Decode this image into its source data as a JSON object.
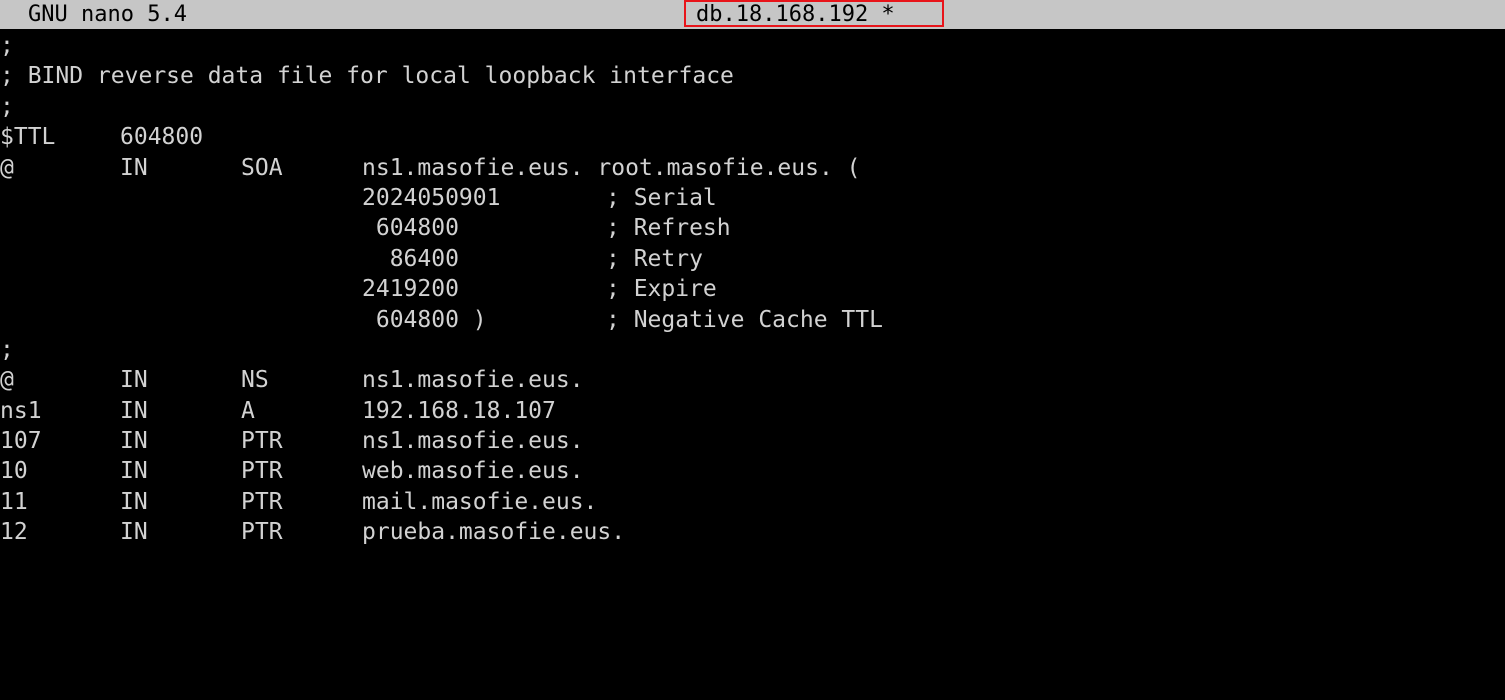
{
  "titlebar": {
    "app": "GNU nano 5.4",
    "file": "db.18.168.192 *"
  },
  "lines": [
    {
      "full": ";"
    },
    {
      "full": "; BIND reverse data file for local loopback interface"
    },
    {
      "full": ";"
    },
    {
      "name": "$TTL",
      "class": "604800"
    },
    {
      "name": "@",
      "class": "IN",
      "type": "SOA",
      "data": "ns1.masofie.eus. root.masofie.eus. ("
    },
    {
      "data": "2024050901",
      "comment": "; Serial"
    },
    {
      "data": " 604800",
      "comment": "; Refresh"
    },
    {
      "data": "  86400",
      "comment": "; Retry"
    },
    {
      "data": "2419200",
      "comment": "; Expire"
    },
    {
      "data": " 604800 )",
      "comment": "; Negative Cache TTL"
    },
    {
      "full": ";"
    },
    {
      "name": "@",
      "class": "IN",
      "type": "NS",
      "data": "ns1.masofie.eus."
    },
    {
      "name": "ns1",
      "class": "IN",
      "type": "A",
      "data": "192.168.18.107"
    },
    {
      "name": "107",
      "class": "IN",
      "type": "PTR",
      "data": "ns1.masofie.eus."
    },
    {
      "name": "10",
      "class": "IN",
      "type": "PTR",
      "data": "web.masofie.eus."
    },
    {
      "name": "11",
      "class": "IN",
      "type": "PTR",
      "data": "mail.masofie.eus."
    },
    {
      "name": "12",
      "class": "IN",
      "type": "PTR",
      "data": "prueba.masofie.eus."
    }
  ],
  "colors": {
    "titlebar_bg": "#c6c6c6",
    "editor_bg": "#000000",
    "text": "#d2d2d2",
    "highlight_border": "#e8141a"
  }
}
